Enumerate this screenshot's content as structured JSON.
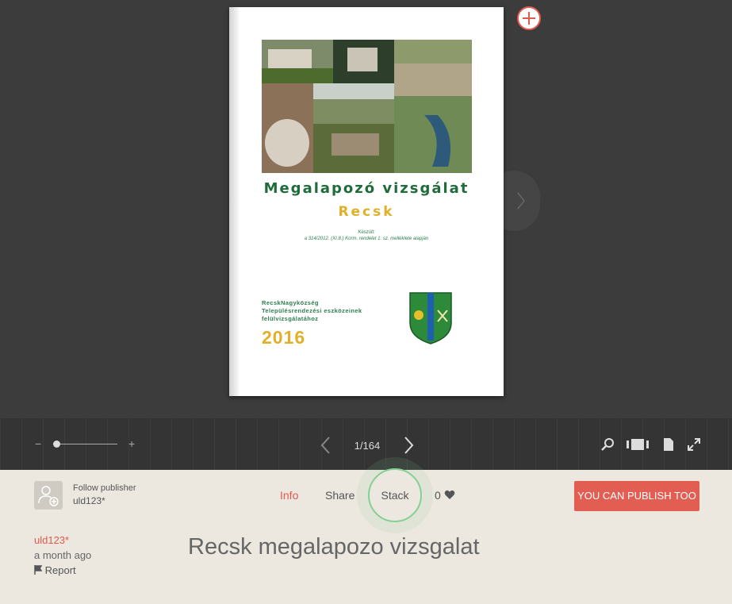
{
  "cover": {
    "title": "Megalapozó vizsgálat",
    "subtitle": "Recsk",
    "note_line1": "Készült:",
    "note_line2": "a 314/2012. (XI.8.) Korm. rendelet 1. sz. melléklete alapján",
    "org_line1": "RecskNagyközség",
    "org_line2": "Településrendezési eszközeinek",
    "org_line3": "felülvizsgálatához",
    "year": "2016"
  },
  "toolbar": {
    "zoom_minus": "−",
    "zoom_plus": "+",
    "page_count": "1/164"
  },
  "publisher": {
    "follow_label": "Follow publisher",
    "name": "uld123*"
  },
  "tabs": {
    "info": "Info",
    "share": "Share",
    "stack": "Stack"
  },
  "likes": {
    "count": "0"
  },
  "publish_button": "YOU CAN PUBLISH TOO",
  "meta": {
    "user": "uld123*",
    "time": "a month ago",
    "report": "Report"
  },
  "document_title": "Recsk megalapozo vizsgalat",
  "colors": {
    "accent": "#e05a4f",
    "stack_ring": "#84cf95",
    "cover_green": "#1f6b3a",
    "cover_gold": "#e0b02a"
  }
}
